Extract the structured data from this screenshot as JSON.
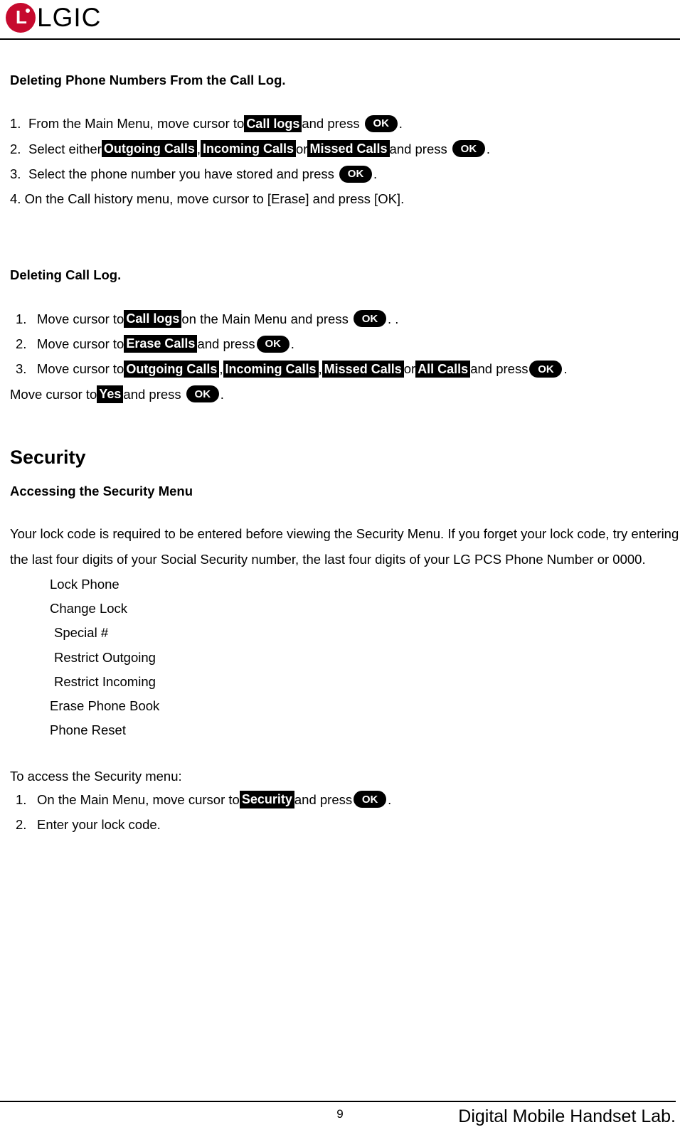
{
  "header": {
    "brand": "LGIC",
    "logo_letter": "L"
  },
  "s1": {
    "title": "Deleting Phone Numbers From the Call Log.",
    "step1_a": "1.",
    "step1_b": "From the Main Menu, move cursor to ",
    "step1_badge": "Call logs",
    "step1_c": " and press ",
    "step1_d": ".",
    "step2_a": "2.",
    "step2_b": "Select either ",
    "step2_badge1": "Outgoing Calls",
    "step2_c": ", ",
    "step2_badge2": "Incoming Calls",
    "step2_d": " or ",
    "step2_badge3": "Missed Calls",
    "step2_e": " and press ",
    "step2_f": " .",
    "step3_a": "3.",
    "step3_b": "Select the phone number you have stored and press ",
    "step3_c": " .",
    "step4": "4. On the Call history menu, move cursor to [Erase] and press [OK]."
  },
  "s2": {
    "title": "Deleting Call Log.",
    "step1_a": "1.",
    "step1_b": "Move cursor to ",
    "step1_badge": "Call logs",
    "step1_c": " on the Main Menu and press ",
    "step1_d": ". .",
    "step2_a": "2.",
    "step2_b": "Move cursor to ",
    "step2_badge": "Erase Calls",
    "step2_c": " and press ",
    "step2_d": " .",
    "step3_a": "3.",
    "step3_b": "Move cursor to ",
    "step3_badge1": "Outgoing Calls",
    "step3_c": ", ",
    "step3_badge2": "Incoming Calls",
    "step3_d": ", ",
    "step3_badge3": "Missed Calls",
    "step3_e": " or ",
    "step3_badge4": "All Calls",
    "step3_f": " and press ",
    "step3_g": " .",
    "step4_a": "Move cursor to ",
    "step4_badge": "Yes",
    "step4_b": " and press ",
    "step4_c": " ."
  },
  "s3": {
    "title": "Security",
    "subtitle": "Accessing the Security Menu",
    "para": "Your lock code is required to be entered before viewing the Security Menu. If you forget your lock code, try entering the last four digits of your Social Security number, the last four digits of your LG PCS Phone Number or 0000.",
    "menu": [
      "Lock Phone",
      "Change Lock",
      "Special #",
      "Restrict Outgoing",
      "Restrict Incoming",
      "Erase Phone Book",
      "Phone Reset"
    ],
    "access_intro": "To access the Security menu:",
    "a1_a": "1.",
    "a1_b": "On the Main Menu, move cursor to ",
    "a1_badge": "Security",
    "a1_c": " and press ",
    "a1_d": " .",
    "a2_a": "2.",
    "a2_b": "Enter your lock code."
  },
  "ok_label": "OK",
  "footer": {
    "page": "9",
    "lab": "Digital Mobile Handset Lab."
  }
}
